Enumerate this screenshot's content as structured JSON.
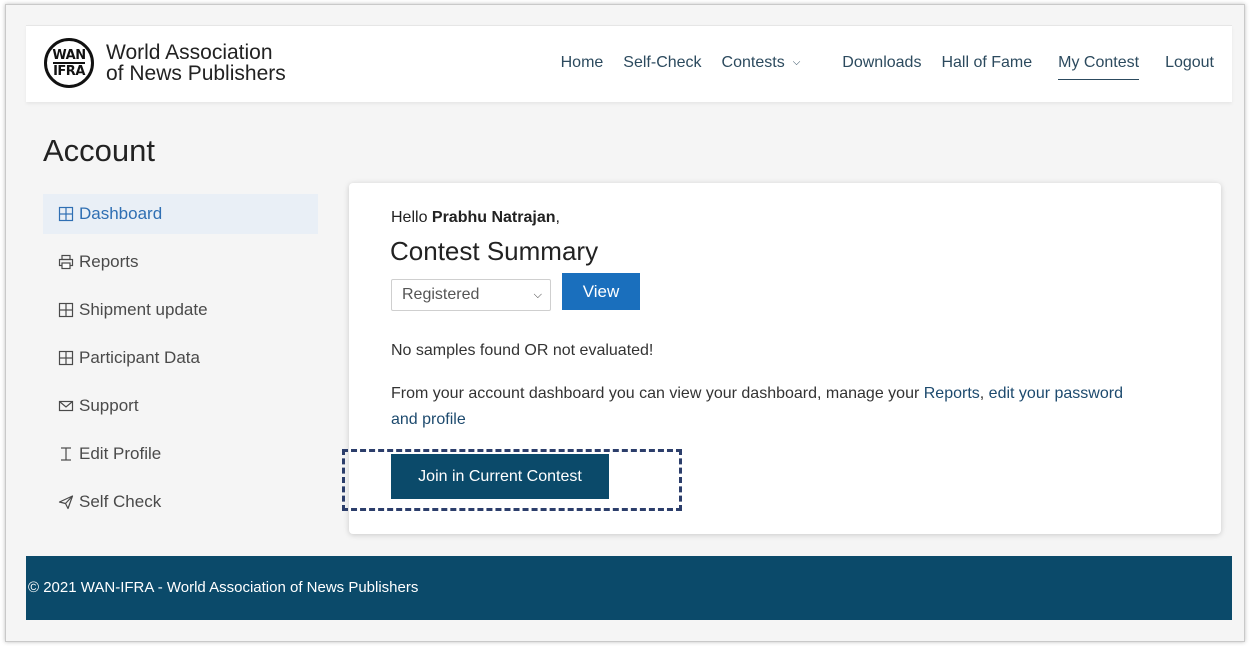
{
  "header": {
    "logo_mark_top": "WAN",
    "logo_mark_bottom": "IFRA",
    "logo_line1": "World Association",
    "logo_line2": "of News Publishers",
    "nav": [
      {
        "label": "Home"
      },
      {
        "label": "Self-Check"
      },
      {
        "label": "Contests"
      },
      {
        "label": "Downloads"
      },
      {
        "label": "Hall of Fame"
      },
      {
        "label": "My Contest"
      },
      {
        "label": "Logout"
      }
    ]
  },
  "page_title": "Account",
  "sidebar": {
    "items": [
      {
        "label": "Dashboard",
        "icon": "grid-icon"
      },
      {
        "label": "Reports",
        "icon": "printer-icon"
      },
      {
        "label": "Shipment update",
        "icon": "grid-icon"
      },
      {
        "label": "Participant Data",
        "icon": "grid-icon"
      },
      {
        "label": "Support",
        "icon": "envelope-icon"
      },
      {
        "label": "Edit Profile",
        "icon": "text-cursor-icon"
      },
      {
        "label": "Self Check",
        "icon": "paper-plane-icon"
      }
    ]
  },
  "card": {
    "greeting_prefix": "Hello ",
    "user_name": "Prabhu Natrajan",
    "greeting_suffix": ",",
    "title": "Contest Summary",
    "select_value": "Registered",
    "view_label": "View",
    "message": "No samples found OR not evaluated!",
    "desc_part1": "From your account dashboard you can view your dashboard, manage your ",
    "desc_link1": "Reports",
    "desc_part2": ", ",
    "desc_link2": "edit your password and profile",
    "join_label": "Join in Current Contest"
  },
  "footer": {
    "text": "© 2021 WAN-IFRA - World Association of News Publishers"
  },
  "colors": {
    "accent": "#1a6fbd",
    "dark_blue": "#0b4a6a",
    "nav_text": "#2c4a5e",
    "active_bg": "#e9eff6"
  }
}
